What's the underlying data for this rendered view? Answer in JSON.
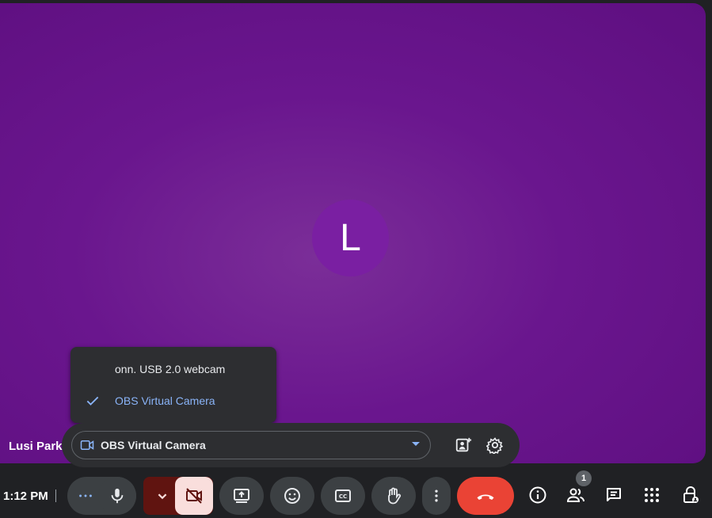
{
  "participant": {
    "name": "Lusi Park",
    "initial": "L"
  },
  "camera_menu": {
    "options": [
      {
        "label": "onn. USB 2.0 webcam",
        "selected": false
      },
      {
        "label": "OBS Virtual Camera",
        "selected": true
      }
    ]
  },
  "camera_bar": {
    "selected_camera": "OBS Virtual Camera"
  },
  "toolbar": {
    "time": "1:12 PM",
    "participants_count": "1"
  },
  "icons": [
    "video-camera-icon",
    "dropdown-arrow-icon",
    "visual-effects-icon",
    "settings-gear-icon",
    "more-options-icon",
    "microphone-icon",
    "chevron-down-icon",
    "camera-off-icon",
    "present-screen-icon",
    "emoji-icon",
    "captions-icon",
    "raise-hand-icon",
    "more-vert-icon",
    "end-call-icon",
    "info-icon",
    "people-icon",
    "chat-icon",
    "activities-icon",
    "host-controls-icon",
    "check-icon"
  ],
  "colors": {
    "stage_background": "#6a168e",
    "avatar": "#7a1fa2",
    "accent": "#8ab4f8",
    "end_call": "#ea4335",
    "camera_off_bg": "#f9dedc",
    "camera_dropdown_bg": "#601410"
  }
}
